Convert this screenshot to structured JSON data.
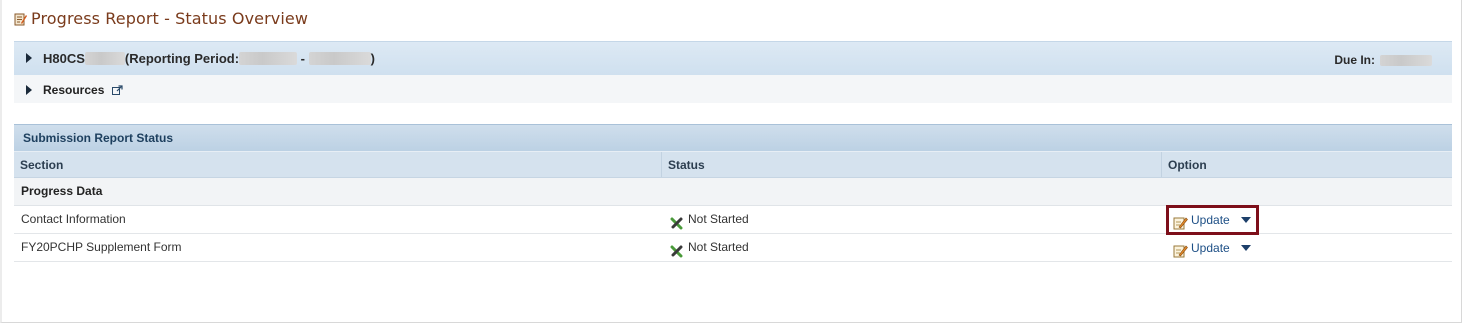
{
  "page": {
    "title": "Progress Report - Status Overview",
    "title_icon": "report-edit-icon"
  },
  "grant": {
    "prefix": "H80CS",
    "period_label": "(Reporting Period:",
    "period_separator": " - ",
    "period_close": ")",
    "due_label": "Due In:"
  },
  "resources": {
    "label": "Resources",
    "icon": "external-link-icon"
  },
  "submission": {
    "header": "Submission Report Status",
    "columns": [
      "Section",
      "Status",
      "Option"
    ],
    "group": "Progress Data",
    "rows": [
      {
        "section": "Contact Information",
        "status": "Not Started",
        "option": "Update",
        "highlighted": true
      },
      {
        "section": "FY20PCHP Supplement Form",
        "status": "Not Started",
        "option": "Update",
        "highlighted": false
      }
    ]
  },
  "colors": {
    "title": "#7a3b1c",
    "header_bg": "#cfdeec",
    "link": "#1d4f86",
    "highlight": "#7d0f1a",
    "status_icon_green": "#4a9a3a",
    "status_icon_dark": "#3a3a3a"
  }
}
